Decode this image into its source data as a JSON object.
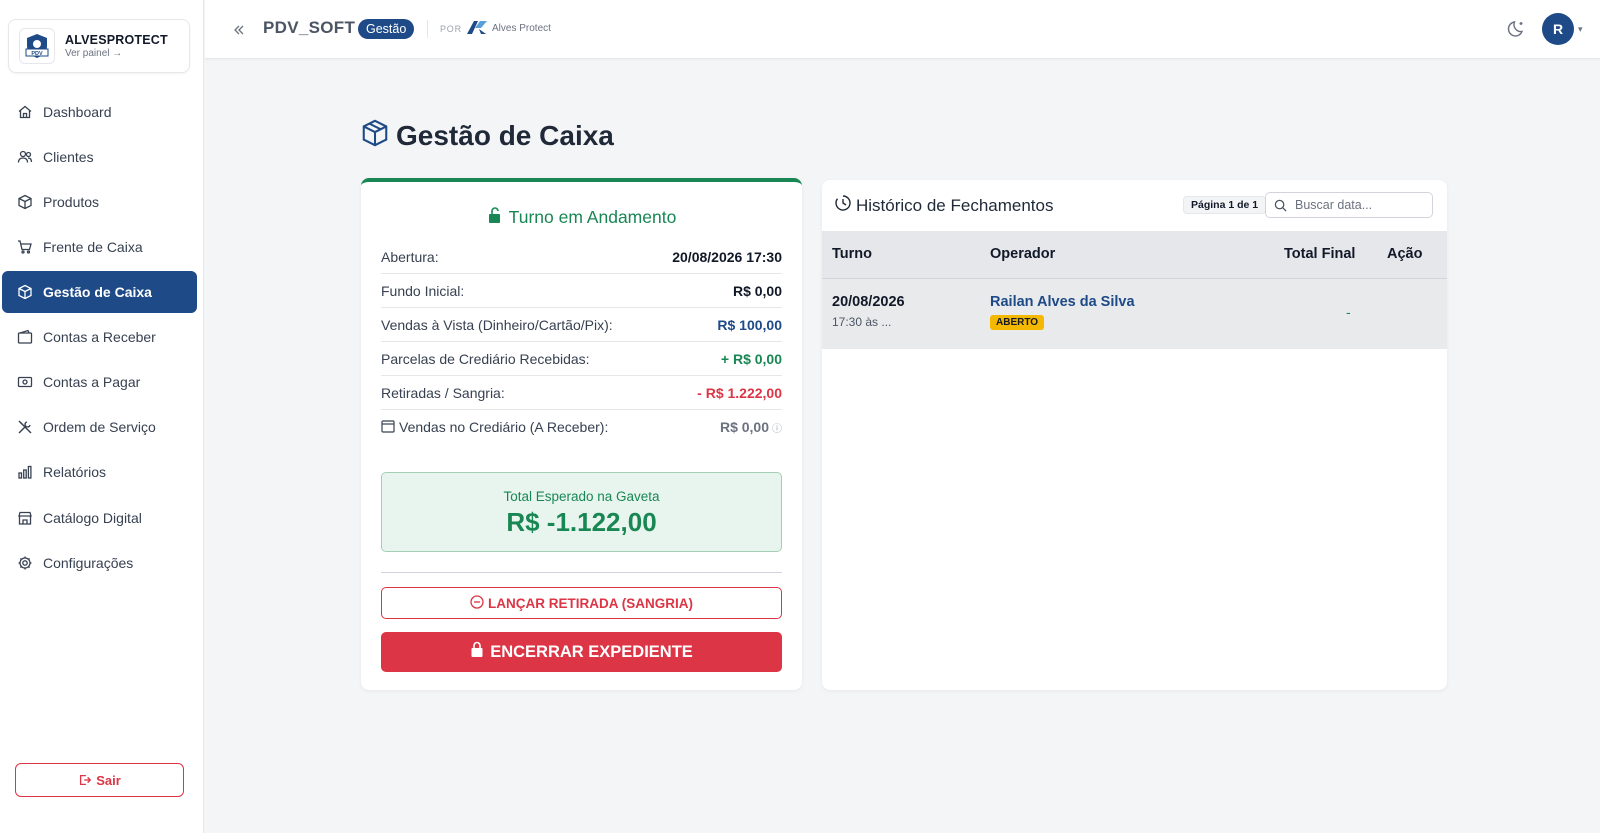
{
  "sidebar": {
    "brand_name": "ALVESPROTECT",
    "brand_sub": "Ver painel →",
    "brand_logo_text": "PDV",
    "items": [
      {
        "label": "Dashboard",
        "icon": "home-icon"
      },
      {
        "label": "Clientes",
        "icon": "users-icon"
      },
      {
        "label": "Produtos",
        "icon": "box-icon"
      },
      {
        "label": "Frente de Caixa",
        "icon": "cart-icon"
      },
      {
        "label": "Gestão de Caixa",
        "icon": "box-icon",
        "active": true
      },
      {
        "label": "Contas a Receber",
        "icon": "wallet-icon"
      },
      {
        "label": "Contas a Pagar",
        "icon": "cash-icon"
      },
      {
        "label": "Ordem de Serviço",
        "icon": "tools-icon"
      },
      {
        "label": "Relatórios",
        "icon": "bar-chart-icon"
      },
      {
        "label": "Catálogo Digital",
        "icon": "shop-icon"
      },
      {
        "label": "Configurações",
        "icon": "gear-icon"
      }
    ],
    "logout_label": "Sair"
  },
  "topbar": {
    "app_name": "PDV_SOFT",
    "badge": "Gestão",
    "por": "POR",
    "partner": "Alves Protect",
    "avatar_initial": "R"
  },
  "page": {
    "title": "Gestão de Caixa"
  },
  "turno": {
    "title": "Turno em Andamento",
    "rows": [
      {
        "label": "Abertura:",
        "value": "20/08/2026 17:30"
      },
      {
        "label": "Fundo Inicial:",
        "value": "R$ 0,00"
      },
      {
        "label": "Vendas à Vista (Dinheiro/Cartão/Pix):",
        "value": "R$ 100,00"
      },
      {
        "label": "Parcelas de Crediário Recebidas:",
        "value": "+ R$ 0,00"
      },
      {
        "label": "Retiradas / Sangria:",
        "value": "- R$ 1.222,00"
      },
      {
        "label": "Vendas no Crediário (A Receber):",
        "value": "R$ 0,00"
      }
    ],
    "total_label": "Total Esperado na Gaveta",
    "total_value": "R$ -1.122,00",
    "sangria_button": "LANÇAR RETIRADA (SANGRIA)",
    "encerrar_button": "ENCERRAR EXPEDIENTE"
  },
  "historico": {
    "title": "Histórico de Fechamentos",
    "pager": "Página 1 de 1",
    "search_placeholder": "Buscar data...",
    "columns": [
      "Turno",
      "Operador",
      "Total Final",
      "Ação"
    ],
    "rows": [
      {
        "date": "20/08/2026",
        "time": "17:30 às ...",
        "operator": "Railan Alves da Silva",
        "status": "ABERTO",
        "total": "-"
      }
    ]
  },
  "colors": {
    "primary": "#1e4a87",
    "success": "#198754",
    "danger": "#dc3545",
    "warning": "#f5b800"
  }
}
